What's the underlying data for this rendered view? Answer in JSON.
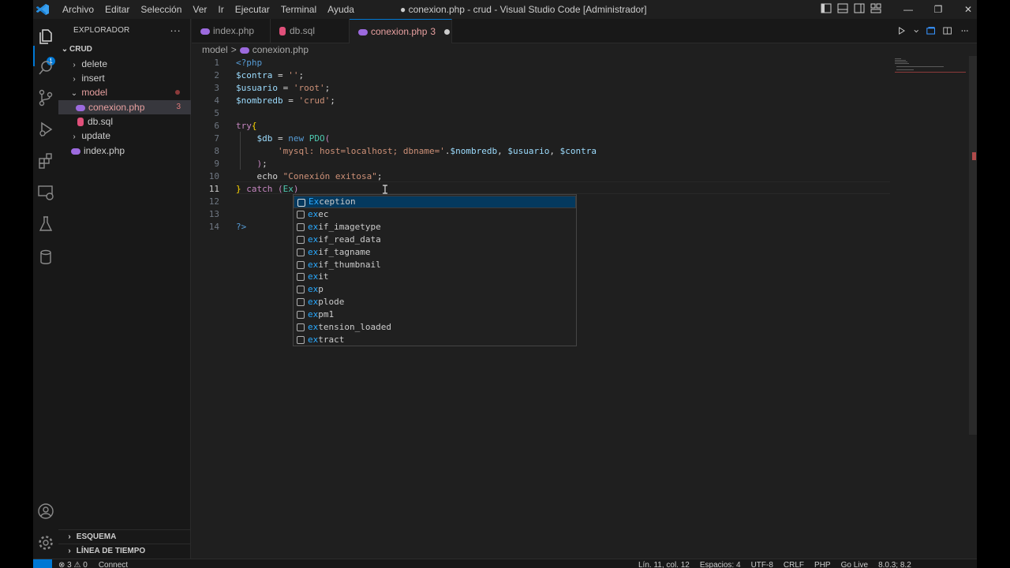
{
  "window": {
    "title": "● conexion.php - crud - Visual Studio Code [Administrador]",
    "controls": [
      "—",
      "❐",
      "✕"
    ]
  },
  "menu": [
    "Archivo",
    "Editar",
    "Selección",
    "Ver",
    "Ir",
    "Ejecutar",
    "Terminal",
    "Ayuda"
  ],
  "activity_icons": [
    "explorer-icon",
    "search-icon",
    "source-control-icon",
    "run-debug-icon",
    "extensions-icon",
    "remote-explorer-icon",
    "testing-icon",
    "database-icon",
    "account-icon",
    "settings-gear-icon"
  ],
  "explorer_badge": "1",
  "sidebar": {
    "title": "EXPLORADOR",
    "more": "···",
    "root": "CRUD",
    "items": [
      {
        "label": "delete",
        "kind": "folder",
        "expanded": false
      },
      {
        "label": "insert",
        "kind": "folder",
        "expanded": false
      },
      {
        "label": "model",
        "kind": "folder",
        "expanded": true,
        "modified": true
      },
      {
        "label": "conexion.php",
        "kind": "php",
        "selected": true,
        "problems": "3"
      },
      {
        "label": "db.sql",
        "kind": "sql"
      },
      {
        "label": "update",
        "kind": "folder",
        "expanded": false
      },
      {
        "label": "index.php",
        "kind": "php"
      }
    ],
    "outline": "ESQUEMA",
    "timeline": "LÍNEA DE TIEMPO"
  },
  "tabs": [
    {
      "label": "index.php",
      "kind": "php"
    },
    {
      "label": "db.sql",
      "kind": "sql"
    },
    {
      "label": "conexion.php",
      "kind": "php",
      "problems": "3",
      "active": true,
      "dirty": true
    }
  ],
  "breadcrumb": [
    "model",
    ">",
    "conexion.php"
  ],
  "editor": {
    "current_line": 11,
    "lines": [
      {
        "n": "1",
        "tokens": [
          {
            "t": "<?php",
            "c": "k-tag"
          }
        ]
      },
      {
        "n": "2",
        "tokens": [
          {
            "t": "$contra",
            "c": "k-var"
          },
          {
            "t": " = ",
            "c": "k-txt"
          },
          {
            "t": "''",
            "c": "k-str"
          },
          {
            "t": ";",
            "c": "k-txt"
          }
        ]
      },
      {
        "n": "3",
        "tokens": [
          {
            "t": "$usuario",
            "c": "k-var"
          },
          {
            "t": " = ",
            "c": "k-txt"
          },
          {
            "t": "'root'",
            "c": "k-str"
          },
          {
            "t": ";",
            "c": "k-txt"
          }
        ]
      },
      {
        "n": "4",
        "tokens": [
          {
            "t": "$nombredb",
            "c": "k-var"
          },
          {
            "t": " = ",
            "c": "k-txt"
          },
          {
            "t": "'crud'",
            "c": "k-str"
          },
          {
            "t": ";",
            "c": "k-txt"
          }
        ]
      },
      {
        "n": "5",
        "tokens": []
      },
      {
        "n": "6",
        "tokens": [
          {
            "t": "try",
            "c": "k-ctl"
          },
          {
            "t": "{",
            "c": "k-br"
          }
        ]
      },
      {
        "n": "7",
        "tokens": [
          {
            "t": "    ",
            "c": "k-txt"
          },
          {
            "t": "$db",
            "c": "k-var"
          },
          {
            "t": " = ",
            "c": "k-txt"
          },
          {
            "t": "new",
            "c": "k-tag"
          },
          {
            "t": " ",
            "c": "k-txt"
          },
          {
            "t": "PDO",
            "c": "k-cls"
          },
          {
            "t": "(",
            "c": "k-ctl"
          }
        ]
      },
      {
        "n": "8",
        "tokens": [
          {
            "t": "        ",
            "c": "k-txt"
          },
          {
            "t": "'mysql: host=localhost; dbname='",
            "c": "k-str"
          },
          {
            "t": ".",
            "c": "k-txt"
          },
          {
            "t": "$nombredb",
            "c": "k-var"
          },
          {
            "t": ", ",
            "c": "k-txt"
          },
          {
            "t": "$usuario",
            "c": "k-var"
          },
          {
            "t": ", ",
            "c": "k-txt"
          },
          {
            "t": "$contra",
            "c": "k-var"
          }
        ]
      },
      {
        "n": "9",
        "tokens": [
          {
            "t": "    ",
            "c": "k-txt"
          },
          {
            "t": ")",
            "c": "k-ctl"
          },
          {
            "t": ";",
            "c": "k-txt"
          }
        ]
      },
      {
        "n": "10",
        "tokens": [
          {
            "t": "    ",
            "c": "k-txt"
          },
          {
            "t": "echo",
            "c": "k-txt"
          },
          {
            "t": " ",
            "c": "k-txt"
          },
          {
            "t": "\"Conexión exitosa\"",
            "c": "k-str"
          },
          {
            "t": ";",
            "c": "k-txt"
          }
        ]
      },
      {
        "n": "11",
        "tokens": [
          {
            "t": "}",
            "c": "k-br"
          },
          {
            "t": " catch ",
            "c": "k-ctl"
          },
          {
            "t": "(",
            "c": "k-ctl"
          },
          {
            "t": "Ex",
            "c": "k-cls"
          },
          {
            "t": ")",
            "c": "k-ctl"
          }
        ]
      },
      {
        "n": "12",
        "tokens": []
      },
      {
        "n": "13",
        "tokens": []
      },
      {
        "n": "14",
        "tokens": [
          {
            "t": "?>",
            "c": "k-tag"
          }
        ]
      }
    ]
  },
  "suggestions": {
    "match": "ex",
    "items": [
      {
        "label": "Exception",
        "kind": "class",
        "selected": true
      },
      {
        "label": "exec",
        "kind": "function"
      },
      {
        "label": "exif_imagetype",
        "kind": "function"
      },
      {
        "label": "exif_read_data",
        "kind": "function"
      },
      {
        "label": "exif_tagname",
        "kind": "function"
      },
      {
        "label": "exif_thumbnail",
        "kind": "function"
      },
      {
        "label": "exit",
        "kind": "function"
      },
      {
        "label": "exp",
        "kind": "function"
      },
      {
        "label": "explode",
        "kind": "function"
      },
      {
        "label": "expm1",
        "kind": "function"
      },
      {
        "label": "extension_loaded",
        "kind": "function"
      },
      {
        "label": "extract",
        "kind": "function"
      }
    ]
  },
  "status": {
    "problems": "⊗ 3 ⚠ 0",
    "connect": "Connect",
    "position": "Lín. 11, col. 12",
    "spaces": "Espacios: 4",
    "encoding": "UTF-8",
    "eol": "CRLF",
    "language": "PHP",
    "golive": "Go Live",
    "php_version": "8.0.3; 8.2"
  },
  "colors": {
    "accent": "#0078d4",
    "editor_bg": "#1f1f1f",
    "sidebar_bg": "#181818",
    "error": "#e8a0a0"
  }
}
